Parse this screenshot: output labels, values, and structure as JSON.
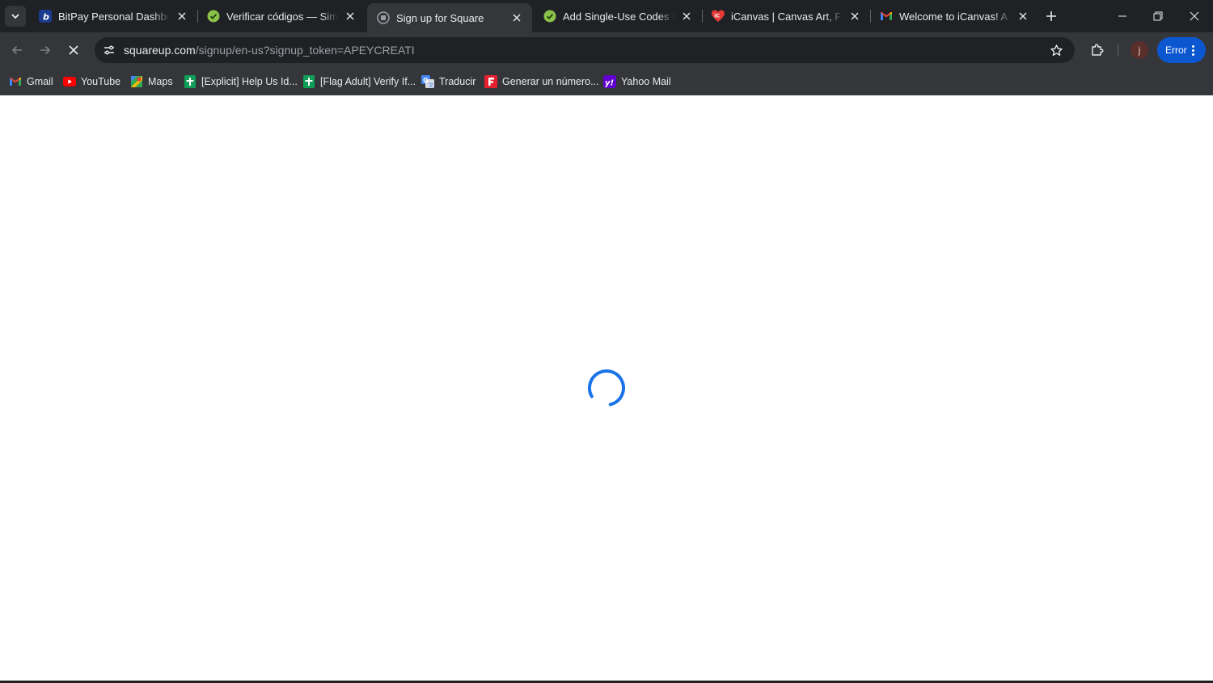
{
  "tabs": [
    {
      "title": "BitPay Personal Dashboard",
      "favicon": "bitpay-icon",
      "active": false
    },
    {
      "title": "Verificar códigos — Simply",
      "favicon": "checkmark-circle-icon",
      "active": false
    },
    {
      "title": "Sign up for Square",
      "favicon": "square-icon",
      "active": true
    },
    {
      "title": "Add Single-Use Codes for",
      "favicon": "checkmark-circle-icon",
      "active": false
    },
    {
      "title": "iCanvas | Canvas Art, Frame",
      "favicon": "icanvas-icon",
      "active": false
    },
    {
      "title": "Welcome to iCanvas! A wo",
      "favicon": "gmail-icon",
      "active": false
    }
  ],
  "toolbar": {
    "url_host": "squareup.com",
    "url_path": "/signup/en-us?signup_token=APEYCREATI",
    "profile_initial": "j",
    "error_label": "Error"
  },
  "bookmarks": [
    {
      "label": "Gmail",
      "icon": "gmail-icon"
    },
    {
      "label": "YouTube",
      "icon": "youtube-icon"
    },
    {
      "label": "Maps",
      "icon": "maps-icon"
    },
    {
      "label": "[Explicit] Help Us Id...",
      "icon": "plus-sheet-icon"
    },
    {
      "label": "[Flag Adult] Verify If...",
      "icon": "plus-sheet-icon"
    },
    {
      "label": "Traducir",
      "icon": "translate-icon"
    },
    {
      "label": "Generar un número...",
      "icon": "f-icon"
    },
    {
      "label": "Yahoo Mail",
      "icon": "yahoo-icon"
    }
  ],
  "content": {
    "state": "loading",
    "spinner_color": "#1a73e8"
  },
  "colors": {
    "tabstrip": "#202124",
    "toolbar": "#35363a",
    "accent": "#0b57d0"
  }
}
